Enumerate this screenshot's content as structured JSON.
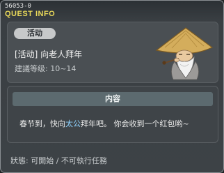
{
  "header": {
    "quest_id": "56053-0",
    "title": "QUEST INFO"
  },
  "quest": {
    "badge": "活动",
    "name": "[活动] 向老人拜年",
    "level": "建議等级: 10~14",
    "npc_icon": "old-sage-with-straw-hat-icon"
  },
  "content": {
    "header": "内容",
    "text_before": "春节到，快向",
    "text_highlight": "太公",
    "text_after": "拜年吧。 你会收到一个红包哟~"
  },
  "status": {
    "text": "狀態: 可開始 / 不可執行任務"
  },
  "colors": {
    "title": "#e9d95a",
    "highlight": "#8fd3ff"
  }
}
